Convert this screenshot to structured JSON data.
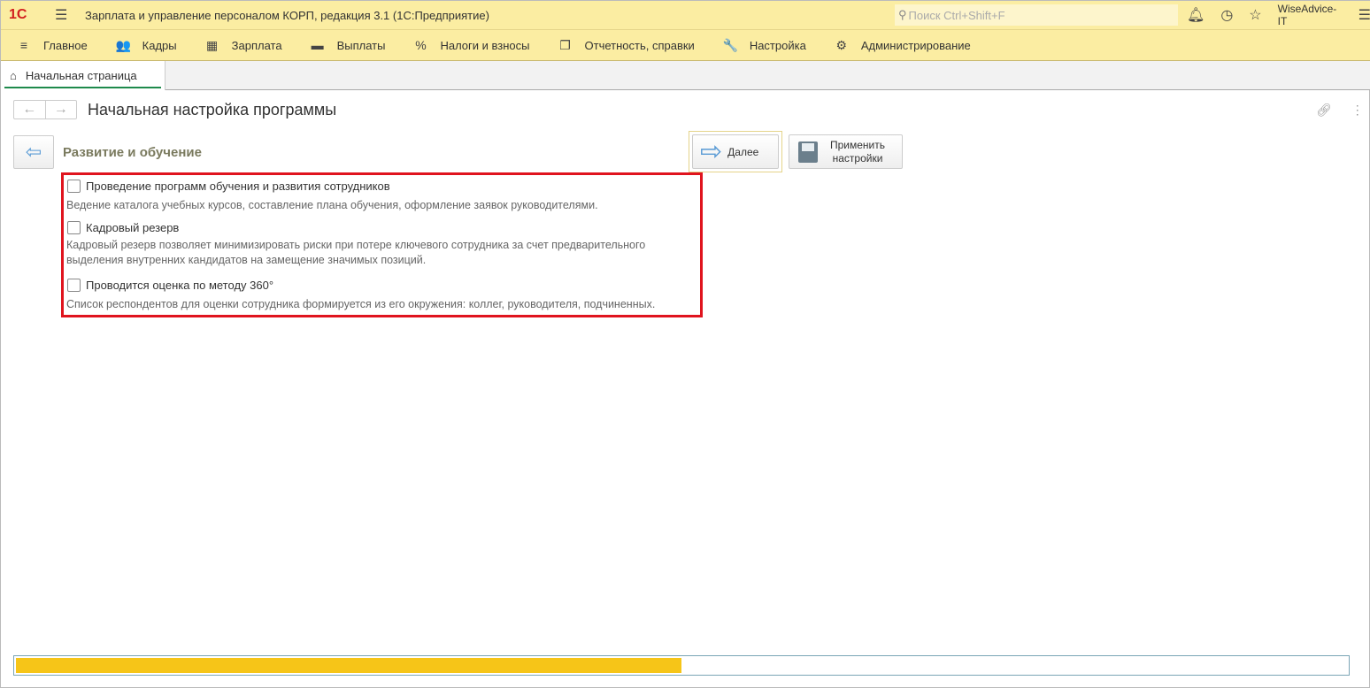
{
  "titlebar": {
    "logo": "1С",
    "title": "Зарплата и управление персоналом КОРП, редакция 3.1  (1С:Предприятие)",
    "search_placeholder": "Поиск Ctrl+Shift+F",
    "user": "WiseAdvice-IT"
  },
  "menu": [
    {
      "label": "Главное",
      "icon": "≡"
    },
    {
      "label": "Кадры",
      "icon": "👥"
    },
    {
      "label": "Зарплата",
      "icon": "▦"
    },
    {
      "label": "Выплаты",
      "icon": "▬"
    },
    {
      "label": "Налоги и взносы",
      "icon": "%"
    },
    {
      "label": "Отчетность, справки",
      "icon": "❐"
    },
    {
      "label": "Настройка",
      "icon": "🔧"
    },
    {
      "label": "Администрирование",
      "icon": "⚙"
    }
  ],
  "tab": {
    "label": "Начальная страница"
  },
  "form": {
    "title": "Начальная настройка программы",
    "section": "Развитие и обучение",
    "next_label": "Далее",
    "apply_label_1": "Применить",
    "apply_label_2": "настройки"
  },
  "options": [
    {
      "label": "Проведение программ обучения и развития сотрудников",
      "checked": false,
      "description": "Ведение каталога учебных курсов, составление плана обучения, оформление заявок руководителями."
    },
    {
      "label": "Кадровый резерв",
      "checked": false,
      "description": "Кадровый резерв позволяет минимизировать риски при потере ключевого сотрудника за счет предварительного выделения внутренних кандидатов на замещение значимых позиций."
    },
    {
      "label": "Проводится оценка по методу 360°",
      "checked": false,
      "description": "Список респондентов для оценки сотрудника  формируется из его окружения: коллег, руководителя, подчиненных."
    }
  ],
  "progress": {
    "fraction": 0.5,
    "color": "#f6c518"
  }
}
